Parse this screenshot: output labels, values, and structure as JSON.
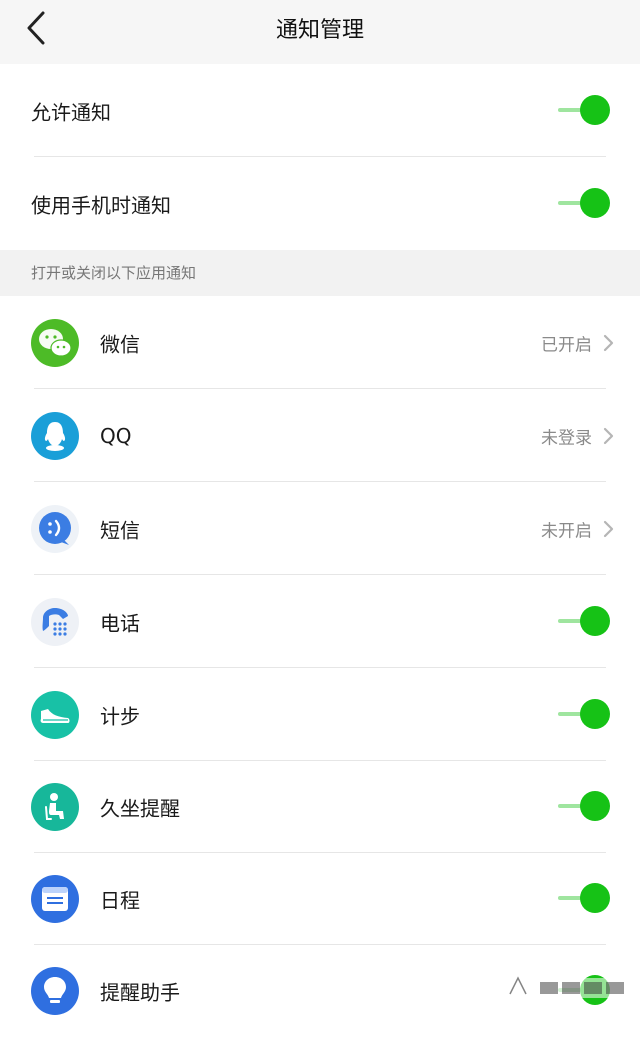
{
  "header": {
    "title": "通知管理"
  },
  "settings": {
    "allow": {
      "label": "允许通知",
      "enabled": true
    },
    "in_use": {
      "label": "使用手机时通知",
      "enabled": true
    }
  },
  "section": {
    "title": "打开或关闭以下应用通知"
  },
  "apps": [
    {
      "label": "微信",
      "status": "已开启",
      "icon": "wechat-icon"
    },
    {
      "label": "QQ",
      "status": "未登录",
      "icon": "qq-icon"
    },
    {
      "label": "短信",
      "status": "未开启",
      "icon": "sms-icon"
    },
    {
      "label": "电话",
      "enabled": true,
      "icon": "phone-icon"
    },
    {
      "label": "计步",
      "enabled": true,
      "icon": "shoe-icon"
    },
    {
      "label": "久坐提醒",
      "enabled": true,
      "icon": "sitting-icon"
    },
    {
      "label": "日程",
      "enabled": true,
      "icon": "calendar-icon"
    },
    {
      "label": "提醒助手",
      "enabled": true,
      "icon": "bulb-icon"
    }
  ],
  "colors": {
    "toggle_on": "#16c216",
    "toggle_track": "#9fe59f",
    "section_bg": "#f2f2f2"
  }
}
